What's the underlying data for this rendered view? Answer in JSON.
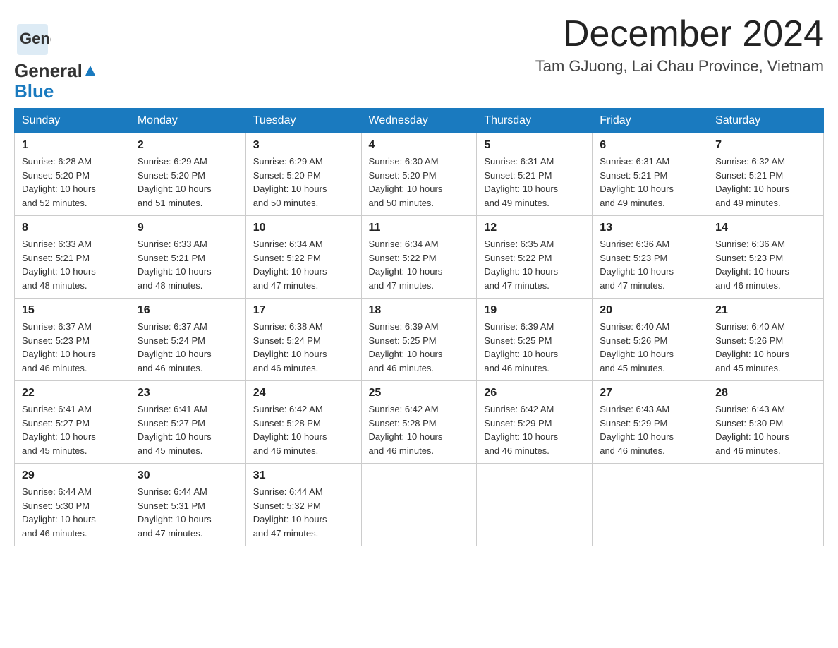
{
  "logo": {
    "general": "General",
    "blue": "Blue"
  },
  "title": {
    "month_year": "December 2024",
    "location": "Tam GJuong, Lai Chau Province, Vietnam"
  },
  "days_of_week": [
    "Sunday",
    "Monday",
    "Tuesday",
    "Wednesday",
    "Thursday",
    "Friday",
    "Saturday"
  ],
  "weeks": [
    [
      {
        "day": "1",
        "sunrise": "6:28 AM",
        "sunset": "5:20 PM",
        "daylight": "10 hours and 52 minutes."
      },
      {
        "day": "2",
        "sunrise": "6:29 AM",
        "sunset": "5:20 PM",
        "daylight": "10 hours and 51 minutes."
      },
      {
        "day": "3",
        "sunrise": "6:29 AM",
        "sunset": "5:20 PM",
        "daylight": "10 hours and 50 minutes."
      },
      {
        "day": "4",
        "sunrise": "6:30 AM",
        "sunset": "5:20 PM",
        "daylight": "10 hours and 50 minutes."
      },
      {
        "day": "5",
        "sunrise": "6:31 AM",
        "sunset": "5:21 PM",
        "daylight": "10 hours and 49 minutes."
      },
      {
        "day": "6",
        "sunrise": "6:31 AM",
        "sunset": "5:21 PM",
        "daylight": "10 hours and 49 minutes."
      },
      {
        "day": "7",
        "sunrise": "6:32 AM",
        "sunset": "5:21 PM",
        "daylight": "10 hours and 49 minutes."
      }
    ],
    [
      {
        "day": "8",
        "sunrise": "6:33 AM",
        "sunset": "5:21 PM",
        "daylight": "10 hours and 48 minutes."
      },
      {
        "day": "9",
        "sunrise": "6:33 AM",
        "sunset": "5:21 PM",
        "daylight": "10 hours and 48 minutes."
      },
      {
        "day": "10",
        "sunrise": "6:34 AM",
        "sunset": "5:22 PM",
        "daylight": "10 hours and 47 minutes."
      },
      {
        "day": "11",
        "sunrise": "6:34 AM",
        "sunset": "5:22 PM",
        "daylight": "10 hours and 47 minutes."
      },
      {
        "day": "12",
        "sunrise": "6:35 AM",
        "sunset": "5:22 PM",
        "daylight": "10 hours and 47 minutes."
      },
      {
        "day": "13",
        "sunrise": "6:36 AM",
        "sunset": "5:23 PM",
        "daylight": "10 hours and 47 minutes."
      },
      {
        "day": "14",
        "sunrise": "6:36 AM",
        "sunset": "5:23 PM",
        "daylight": "10 hours and 46 minutes."
      }
    ],
    [
      {
        "day": "15",
        "sunrise": "6:37 AM",
        "sunset": "5:23 PM",
        "daylight": "10 hours and 46 minutes."
      },
      {
        "day": "16",
        "sunrise": "6:37 AM",
        "sunset": "5:24 PM",
        "daylight": "10 hours and 46 minutes."
      },
      {
        "day": "17",
        "sunrise": "6:38 AM",
        "sunset": "5:24 PM",
        "daylight": "10 hours and 46 minutes."
      },
      {
        "day": "18",
        "sunrise": "6:39 AM",
        "sunset": "5:25 PM",
        "daylight": "10 hours and 46 minutes."
      },
      {
        "day": "19",
        "sunrise": "6:39 AM",
        "sunset": "5:25 PM",
        "daylight": "10 hours and 46 minutes."
      },
      {
        "day": "20",
        "sunrise": "6:40 AM",
        "sunset": "5:26 PM",
        "daylight": "10 hours and 45 minutes."
      },
      {
        "day": "21",
        "sunrise": "6:40 AM",
        "sunset": "5:26 PM",
        "daylight": "10 hours and 45 minutes."
      }
    ],
    [
      {
        "day": "22",
        "sunrise": "6:41 AM",
        "sunset": "5:27 PM",
        "daylight": "10 hours and 45 minutes."
      },
      {
        "day": "23",
        "sunrise": "6:41 AM",
        "sunset": "5:27 PM",
        "daylight": "10 hours and 45 minutes."
      },
      {
        "day": "24",
        "sunrise": "6:42 AM",
        "sunset": "5:28 PM",
        "daylight": "10 hours and 46 minutes."
      },
      {
        "day": "25",
        "sunrise": "6:42 AM",
        "sunset": "5:28 PM",
        "daylight": "10 hours and 46 minutes."
      },
      {
        "day": "26",
        "sunrise": "6:42 AM",
        "sunset": "5:29 PM",
        "daylight": "10 hours and 46 minutes."
      },
      {
        "day": "27",
        "sunrise": "6:43 AM",
        "sunset": "5:29 PM",
        "daylight": "10 hours and 46 minutes."
      },
      {
        "day": "28",
        "sunrise": "6:43 AM",
        "sunset": "5:30 PM",
        "daylight": "10 hours and 46 minutes."
      }
    ],
    [
      {
        "day": "29",
        "sunrise": "6:44 AM",
        "sunset": "5:30 PM",
        "daylight": "10 hours and 46 minutes."
      },
      {
        "day": "30",
        "sunrise": "6:44 AM",
        "sunset": "5:31 PM",
        "daylight": "10 hours and 47 minutes."
      },
      {
        "day": "31",
        "sunrise": "6:44 AM",
        "sunset": "5:32 PM",
        "daylight": "10 hours and 47 minutes."
      },
      null,
      null,
      null,
      null
    ]
  ],
  "labels": {
    "sunrise": "Sunrise:",
    "sunset": "Sunset:",
    "daylight": "Daylight:"
  }
}
